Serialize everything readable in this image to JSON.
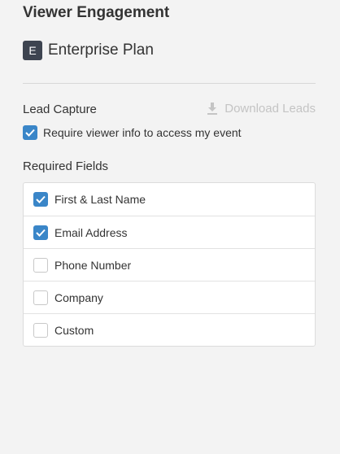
{
  "header": {
    "title": "Viewer Engagement"
  },
  "plan": {
    "badge": "E",
    "name": "Enterprise Plan"
  },
  "lead_capture": {
    "label": "Lead Capture",
    "download_label": "Download Leads",
    "require_label": "Require viewer info to access my event",
    "require_checked": true
  },
  "required_fields": {
    "label": "Required Fields",
    "items": [
      {
        "label": "First & Last Name",
        "checked": true
      },
      {
        "label": "Email Address",
        "checked": true
      },
      {
        "label": "Phone Number",
        "checked": false
      },
      {
        "label": "Company",
        "checked": false
      },
      {
        "label": "Custom",
        "checked": false
      }
    ]
  },
  "colors": {
    "accent": "#3a86c8",
    "badge_bg": "#3d4450",
    "muted": "#c4c4c4"
  },
  "icons": {
    "download": "download-icon",
    "check": "checkmark-icon"
  }
}
